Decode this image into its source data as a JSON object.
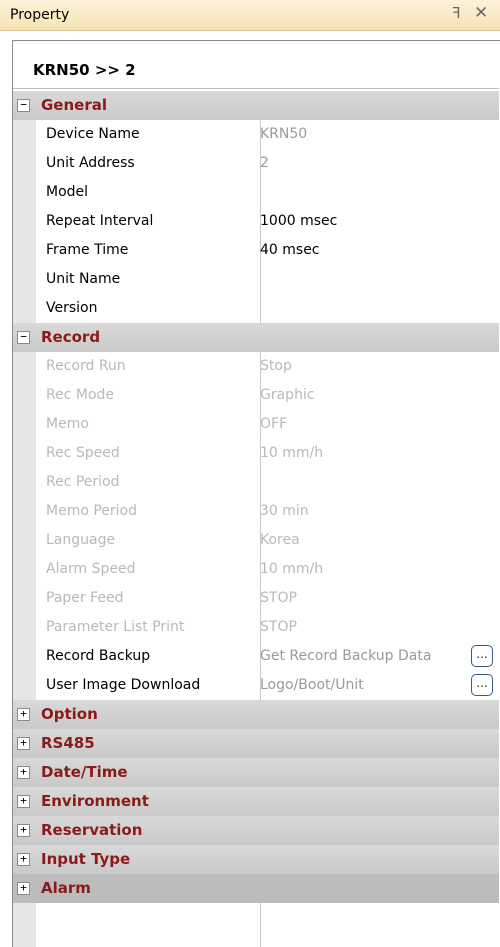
{
  "window": {
    "title": "Property",
    "pin_glyph": "ꟻ",
    "close_glyph": "✕"
  },
  "path": "KRN50 >> 2",
  "general": {
    "label": "General",
    "rows": [
      {
        "name": "Device Name",
        "value": "KRN50"
      },
      {
        "name": "Unit Address",
        "value": "2"
      },
      {
        "name": "Model",
        "value": ""
      },
      {
        "name": "Repeat Interval",
        "value": "1000 msec"
      },
      {
        "name": "Frame Time",
        "value": "40 msec"
      },
      {
        "name": "Unit Name",
        "value": ""
      },
      {
        "name": "Version",
        "value": ""
      }
    ]
  },
  "record": {
    "label": "Record",
    "rows": [
      {
        "name": "Record Run",
        "value": "Stop"
      },
      {
        "name": "Rec Mode",
        "value": "Graphic"
      },
      {
        "name": "Memo",
        "value": "OFF"
      },
      {
        "name": "Rec Speed",
        "value": "10 mm/h"
      },
      {
        "name": "Rec Period",
        "value": ""
      },
      {
        "name": "Memo Period",
        "value": "30 min"
      },
      {
        "name": "Language",
        "value": "Korea"
      },
      {
        "name": "Alarm Speed",
        "value": "10 mm/h"
      },
      {
        "name": "Paper Feed",
        "value": "STOP"
      },
      {
        "name": "Parameter List Print",
        "value": "STOP"
      },
      {
        "name": "Record Backup",
        "value": "Get Record Backup Data",
        "button": "..."
      },
      {
        "name": "User Image Download",
        "value": "Logo/Boot/Unit",
        "button": "..."
      }
    ]
  },
  "collapsed": [
    "Option",
    "RS485",
    "Date/Time",
    "Environment",
    "Reservation",
    "Input Type",
    "Alarm"
  ],
  "expander": {
    "expanded": "−",
    "collapsed": "+"
  }
}
